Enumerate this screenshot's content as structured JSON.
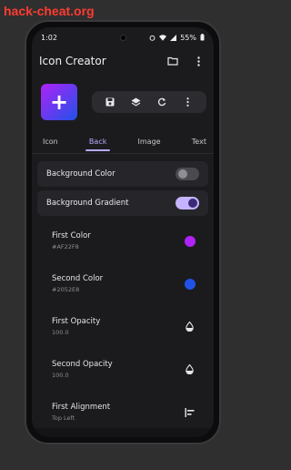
{
  "watermark": "hack-cheat.org",
  "status": {
    "time": "1:02",
    "battery": "55%"
  },
  "appbar": {
    "title": "Icon Creator",
    "folder_icon": "folder-icon",
    "menu_icon": "more-vert-icon"
  },
  "preview": {
    "symbol": "+",
    "gradient_start": "#AF22F8",
    "gradient_end": "#2052E8"
  },
  "actions": [
    "save-icon",
    "layers-icon",
    "refresh-icon",
    "more-vert-icon"
  ],
  "tabs": [
    {
      "label": "Icon",
      "active": false
    },
    {
      "label": "Back",
      "active": true
    },
    {
      "label": "Image",
      "active": false
    },
    {
      "label": "Text",
      "active": false
    }
  ],
  "toggles": [
    {
      "label": "Background Color",
      "on": false
    },
    {
      "label": "Background Gradient",
      "on": true
    }
  ],
  "settings": [
    {
      "title": "First Color",
      "subtitle": "#AF22F8",
      "control": "swatch",
      "color": "#AF22F8"
    },
    {
      "title": "Second Color",
      "subtitle": "#2052E8",
      "control": "swatch",
      "color": "#2052E8"
    },
    {
      "title": "First Opacity",
      "subtitle": "100.0",
      "control": "opacity-icon"
    },
    {
      "title": "Second Opacity",
      "subtitle": "100.0",
      "control": "opacity-icon"
    },
    {
      "title": "First Alignment",
      "subtitle": "Top Left",
      "control": "align-left-icon"
    }
  ],
  "colors": {
    "accent": "#b9a9ff",
    "background": "#1b1b1e",
    "card": "#26262a"
  }
}
